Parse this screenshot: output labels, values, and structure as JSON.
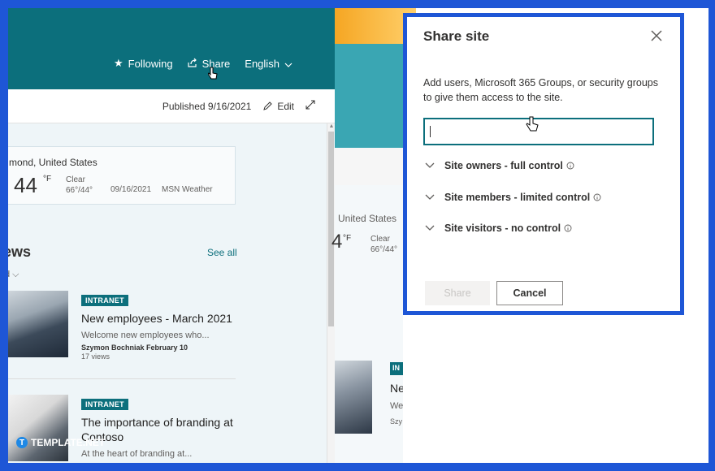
{
  "header": {
    "following_label": "Following",
    "share_label": "Share",
    "language_label": "English"
  },
  "commandbar": {
    "published": "Published 9/16/2021",
    "edit_label": "Edit"
  },
  "weather": {
    "location": "mond, United States",
    "temperature": "44",
    "unit": "°F",
    "condition": "Clear",
    "range": "66°/44°",
    "date": "09/16/2021",
    "source": "MSN Weather"
  },
  "news": {
    "title": "ews",
    "subtitle": "d ⌵",
    "see_all": "See all",
    "items": [
      {
        "tag": "INTRANET",
        "title": "New employees - March 2021",
        "description": "Welcome new employees who...",
        "author": "Szymon Bochniak February 10",
        "views": "17 views"
      },
      {
        "tag": "INTRANET",
        "title": "The importance of branding at Contoso",
        "description": "At the heart of branding at..."
      }
    ]
  },
  "background_page": {
    "location": "United States",
    "temperature": "4",
    "unit": "°F",
    "condition": "Clear",
    "range": "66°/44°",
    "tag": "IN",
    "title": "Ne",
    "desc": "We",
    "author": "Szy"
  },
  "dialog": {
    "title": "Share site",
    "description": "Add users, Microsoft 365 Groups, or security groups to give them access to the site.",
    "input_value": "",
    "permissions": [
      {
        "label": "Site owners - full control"
      },
      {
        "label": "Site members - limited control"
      },
      {
        "label": "Site visitors - no control"
      }
    ],
    "share_button": "Share",
    "cancel_button": "Cancel"
  },
  "watermark": {
    "text": "TEMPLATE.NET"
  },
  "colors": {
    "brand_teal": "#0c6f7c",
    "frame_blue": "#1e56d6"
  }
}
